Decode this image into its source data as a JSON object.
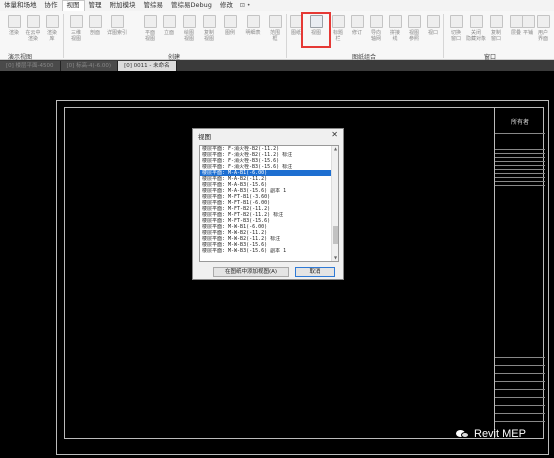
{
  "menubar": {
    "items": [
      "体量和场地",
      "协作",
      "视图",
      "管理",
      "附加模块",
      "管综易",
      "管综易Debug",
      "修改"
    ],
    "active_index": 2,
    "extra": "⊡ •"
  },
  "ribbon": {
    "buttons": [
      "渲染",
      "在云中\n渲染",
      "渲染\n库",
      "三维\n视图",
      "剖面",
      "详图索引",
      "平面\n视图",
      "立面",
      "绘图\n视图",
      "复制\n视图",
      "图例",
      "明细表",
      "范围\n框",
      "图纸",
      "视图",
      "标题\n栏",
      "修订",
      "导向\n轴网",
      "拼接\n线",
      "视图\n参照",
      "视口",
      "切换\n窗口",
      "关闭\n隐藏对象",
      "复制\n窗口",
      "层叠",
      "平铺",
      "用户\n界面"
    ],
    "panels": [
      "演示视图",
      "创建",
      "图纸组合",
      "窗口"
    ]
  },
  "tabs": [
    "[0] 楼层平面-4500",
    "[0] 标高-4(-6.00)",
    "[0] 0011 - 未命名"
  ],
  "dialog": {
    "title": "视图",
    "close": "✕",
    "items": [
      "楼层平面: F-消火栓-B2(-11.2)",
      "楼层平面: F-消火栓-B2(-11.2) 标注",
      "楼层平面: F-消火栓-B3(-15.6)",
      "楼层平面: F-消火栓-B3(-15.6) 标注",
      "楼层平面: M-A-B1(-6.00)",
      "楼层平面: M-A-B2(-11.2)",
      "楼层平面: M-A-B3(-15.6)",
      "楼层平面: M-A-B3(-15.6) 副本 1",
      "楼层平面: M-FT-B1(-3.60)",
      "楼层平面: M-FT-B1(-6.00)",
      "楼层平面: M-FT-B2(-11.2)",
      "楼层平面: M-FT-B2(-11.2) 标注",
      "楼层平面: M-FT-B3(-15.6)",
      "楼层平面: M-W-B1(-6.00)",
      "楼层平面: M-W-B2(-11.2)",
      "楼层平面: M-W-B2(-11.2) 标注",
      "楼层平面: M-W-B3(-15.6)",
      "楼层平面: M-W-B3(-15.6) 副本 1"
    ],
    "selected_index": 4,
    "add_button": "在图纸中添加视图(A)",
    "cancel_button": "取消"
  },
  "titleblock": {
    "owner": "所有者"
  },
  "watermark": {
    "text": "Revit MEP"
  },
  "colors": {
    "highlight": "#e53935",
    "selection": "#1e6fd1",
    "canvas": "#000000"
  }
}
